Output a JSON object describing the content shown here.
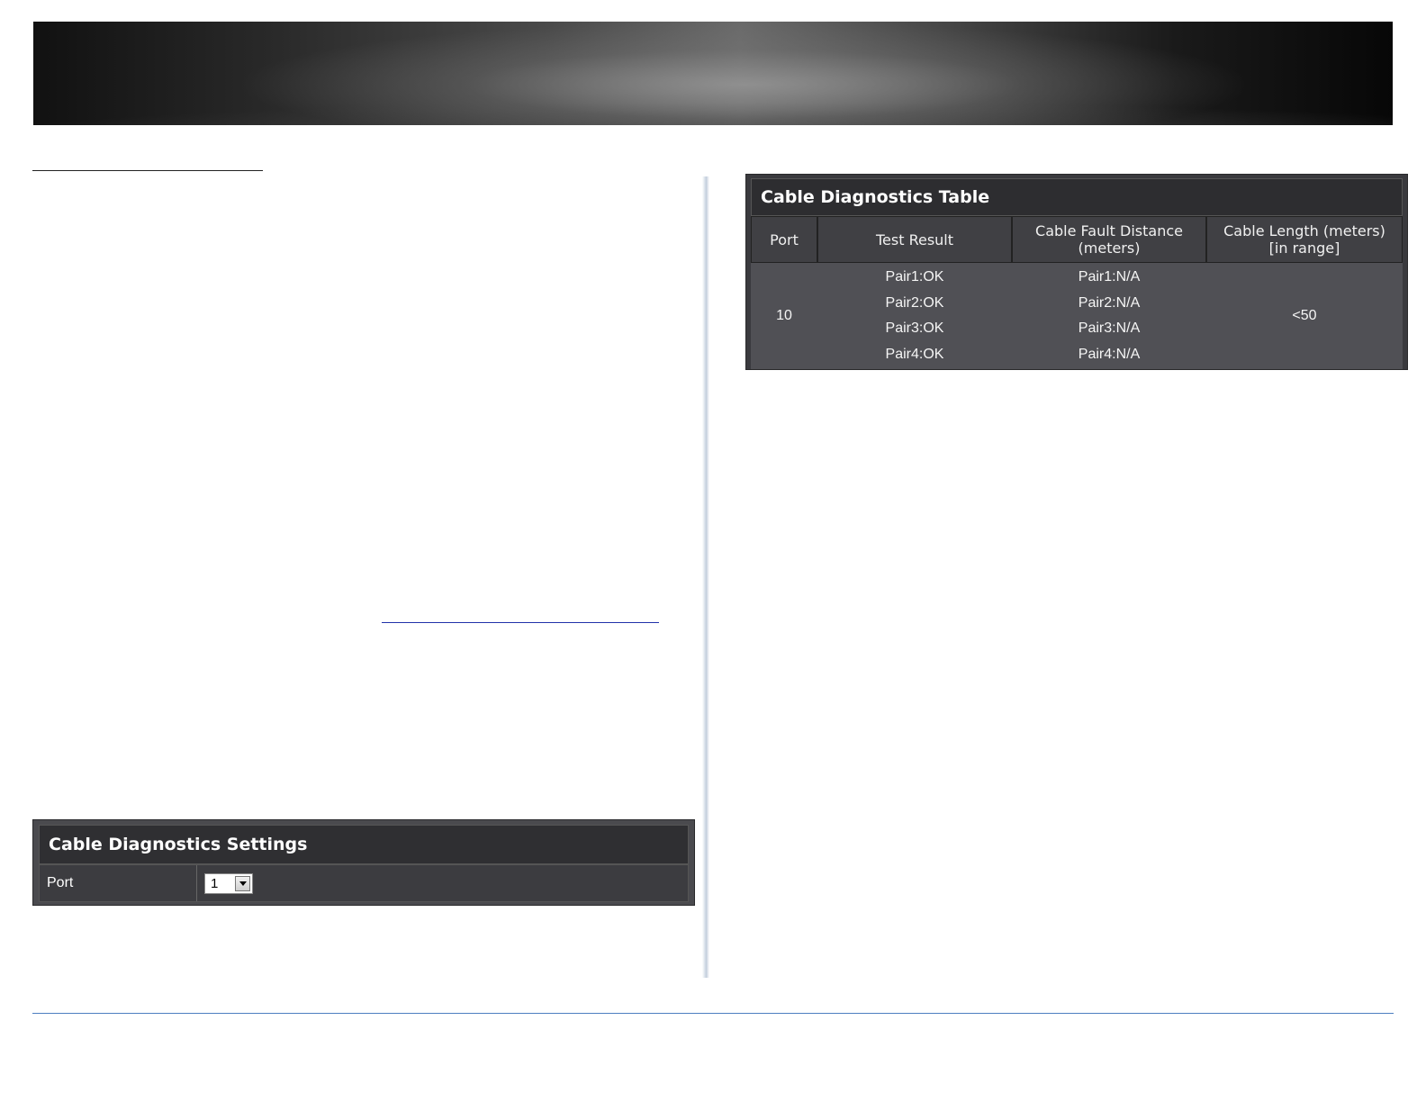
{
  "cable_table": {
    "title": "Cable Diagnostics Table",
    "headers": {
      "port": "Port",
      "test_result": "Test Result",
      "fault_distance": [
        "Cable Fault Distance",
        "(meters)"
      ],
      "cable_length": [
        "Cable Length (meters)",
        "[in range]"
      ]
    },
    "rows": [
      {
        "port": "10",
        "test_result": [
          "Pair1:OK",
          "Pair2:OK",
          "Pair3:OK",
          "Pair4:OK"
        ],
        "fault_distance": [
          "Pair1:N/A",
          "Pair2:N/A",
          "Pair3:N/A",
          "Pair4:N/A"
        ],
        "cable_length": "<50"
      }
    ]
  },
  "settings": {
    "title": "Cable Diagnostics Settings",
    "port_label": "Port",
    "port_value": "1"
  }
}
